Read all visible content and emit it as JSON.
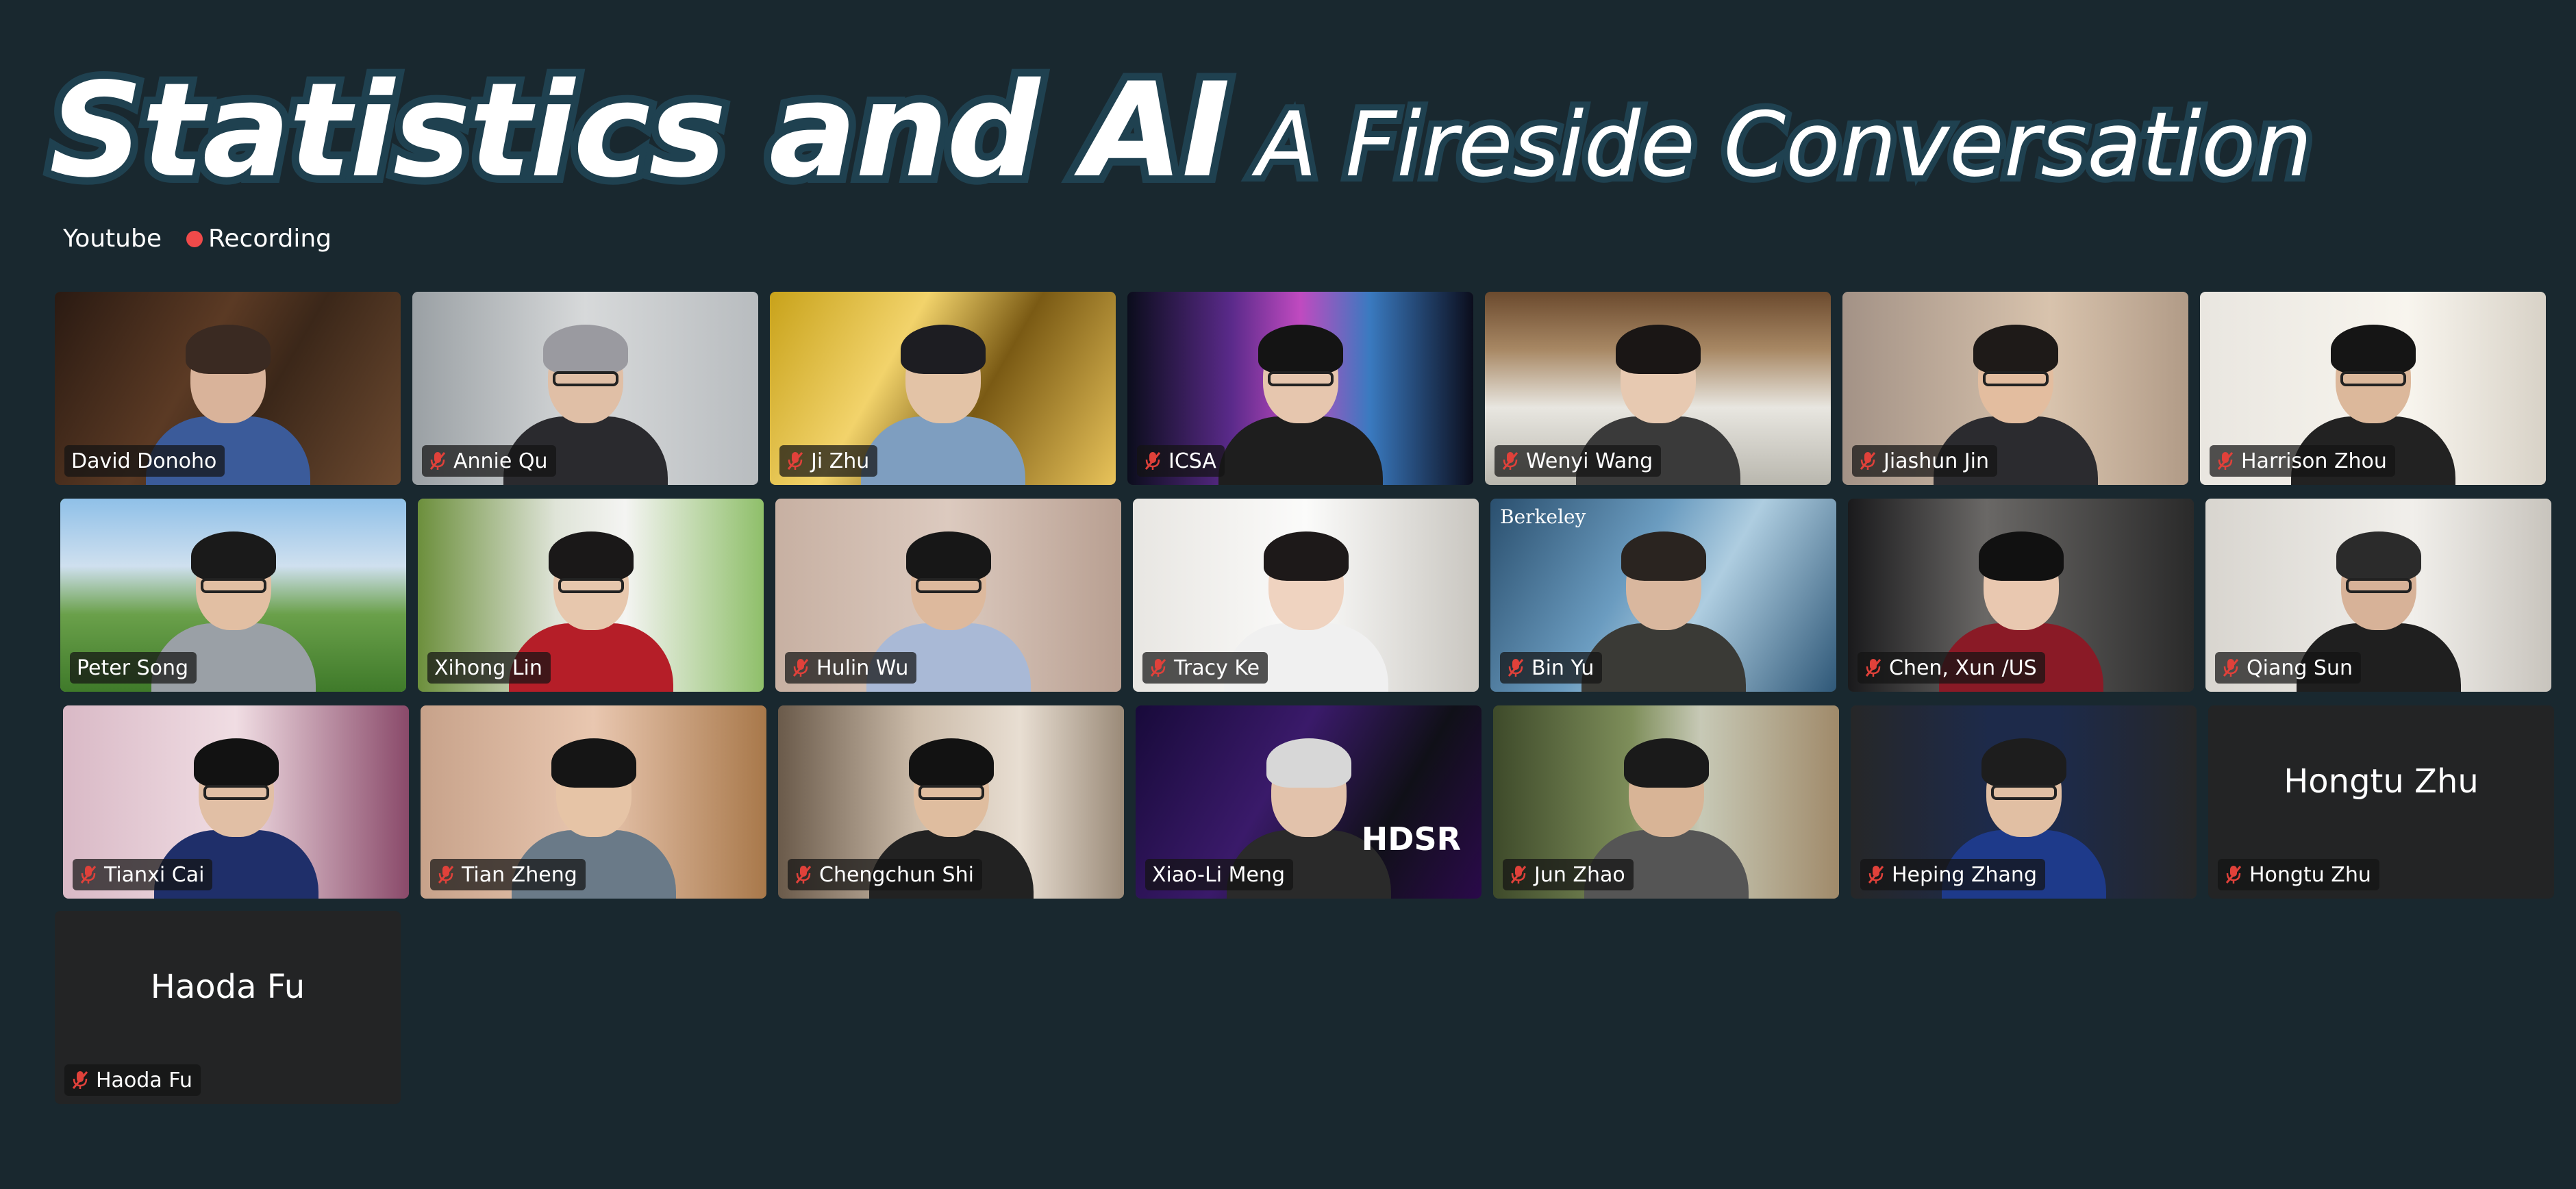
{
  "header": {
    "title_main": "Statistics and AI",
    "title_sub": "A Fireside Conversation"
  },
  "status": {
    "platform": "Youtube",
    "recording": "Recording"
  },
  "participants": [
    {
      "name": "David Donoho",
      "muted": false,
      "active": false,
      "video": true
    },
    {
      "name": "Annie Qu",
      "muted": true,
      "active": false,
      "video": true
    },
    {
      "name": "Ji Zhu",
      "muted": true,
      "active": false,
      "video": true
    },
    {
      "name": "ICSA",
      "muted": true,
      "active": false,
      "video": true
    },
    {
      "name": "Wenyi Wang",
      "muted": true,
      "active": false,
      "video": true
    },
    {
      "name": "Jiashun Jin",
      "muted": true,
      "active": false,
      "video": true
    },
    {
      "name": "Harrison Zhou",
      "muted": true,
      "active": false,
      "video": true
    },
    {
      "name": "Peter Song",
      "muted": false,
      "active": true,
      "video": true
    },
    {
      "name": "Xihong Lin",
      "muted": false,
      "active": false,
      "video": true
    },
    {
      "name": "Hulin Wu",
      "muted": true,
      "active": false,
      "video": true
    },
    {
      "name": "Tracy Ke",
      "muted": true,
      "active": false,
      "video": true
    },
    {
      "name": "Bin Yu",
      "muted": true,
      "active": false,
      "video": true
    },
    {
      "name": "Chen, Xun /US",
      "muted": true,
      "active": false,
      "video": true
    },
    {
      "name": "Qiang Sun",
      "muted": true,
      "active": false,
      "video": true
    },
    {
      "name": "Tianxi Cai",
      "muted": true,
      "active": false,
      "video": true
    },
    {
      "name": "Tian Zheng",
      "muted": true,
      "active": false,
      "video": true
    },
    {
      "name": "Chengchun Shi",
      "muted": true,
      "active": false,
      "video": true
    },
    {
      "name": "Xiao-Li Meng",
      "muted": false,
      "active": false,
      "video": true
    },
    {
      "name": "Jun Zhao",
      "muted": true,
      "active": false,
      "video": true
    },
    {
      "name": "Heping Zhang",
      "muted": true,
      "active": false,
      "video": true
    },
    {
      "name": "Hongtu Zhu",
      "muted": true,
      "active": false,
      "video": false
    },
    {
      "name": "Haoda Fu",
      "muted": true,
      "active": false,
      "video": false
    }
  ],
  "overlays": {
    "icsa_banner": "",
    "berkeley_logo": "Berkeley",
    "hdsr_logo": "HDSR"
  },
  "colors": {
    "background": "#19282f",
    "active_speaker": "#7ed957",
    "recording_dot": "#f04a4a",
    "muted_icon": "#e0413a"
  }
}
